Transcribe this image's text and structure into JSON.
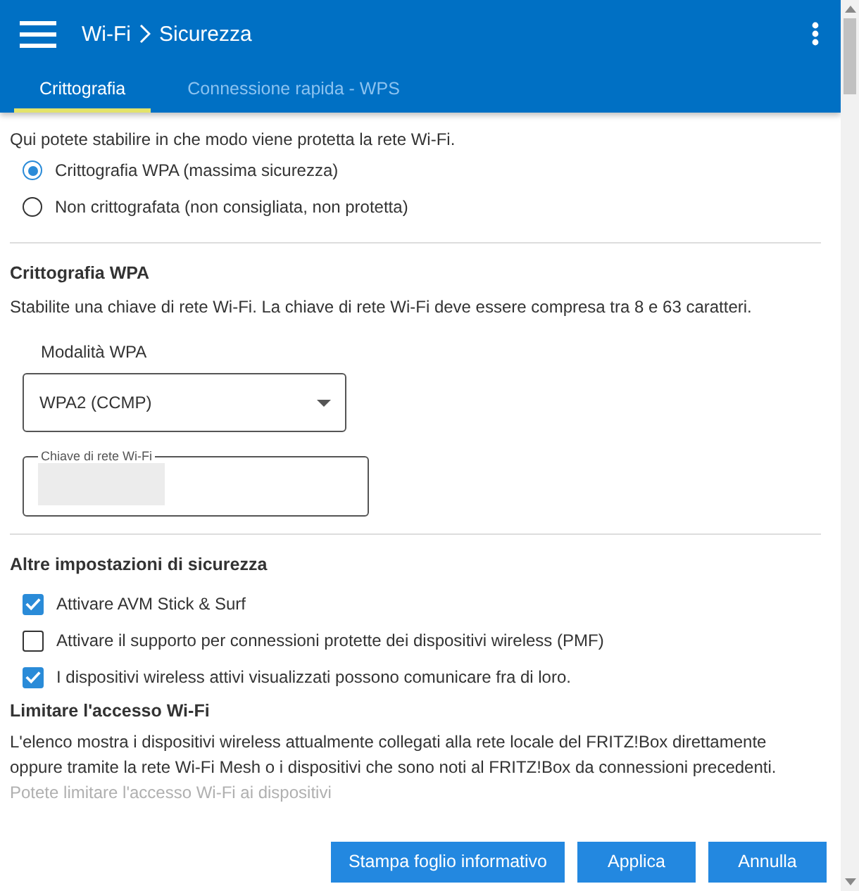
{
  "header": {
    "breadcrumb": [
      "Wi-Fi",
      "Sicurezza"
    ]
  },
  "tabs": [
    {
      "label": "Crittografia",
      "selected": true
    },
    {
      "label": "Connessione rapida - WPS",
      "selected": false
    }
  ],
  "intro": "Qui potete stabilire in che modo viene protetta la rete Wi-Fi.",
  "encryption_options": [
    {
      "label": "Crittografia WPA (massima sicurezza)",
      "selected": true
    },
    {
      "label": "Non crittografata (non consigliata, non protetta)",
      "selected": false
    }
  ],
  "wpa_section": {
    "title": "Crittografia WPA",
    "description": "Stabilite una chiave di rete Wi-Fi. La chiave di rete Wi-Fi deve essere compresa tra 8 e 63 caratteri.",
    "mode_label": "Modalità WPA",
    "mode_value": "WPA2 (CCMP)",
    "key_label": "Chiave di rete Wi-Fi"
  },
  "other_section": {
    "title": "Altre impostazioni di sicurezza",
    "options": [
      {
        "label": "Attivare AVM Stick & Surf",
        "checked": true
      },
      {
        "label": "Attivare il supporto per connessioni protette dei dispositivi wireless (PMF)",
        "checked": false
      },
      {
        "label": "I dispositivi wireless attivi visualizzati possono comunicare fra di loro.",
        "checked": true
      }
    ]
  },
  "access_section": {
    "title": "Limitare l'accesso Wi-Fi",
    "description": "L'elenco mostra i dispositivi wireless attualmente collegati alla rete locale del FRITZ!Box direttamente oppure tramite la rete Wi-Fi Mesh o i dispositivi che sono noti al FRITZ!Box da connessioni precedenti.",
    "faded_text": "Potete limitare l'accesso Wi-Fi ai dispositivi"
  },
  "buttons": [
    "Stampa foglio informativo",
    "Applica",
    "Annulla"
  ]
}
